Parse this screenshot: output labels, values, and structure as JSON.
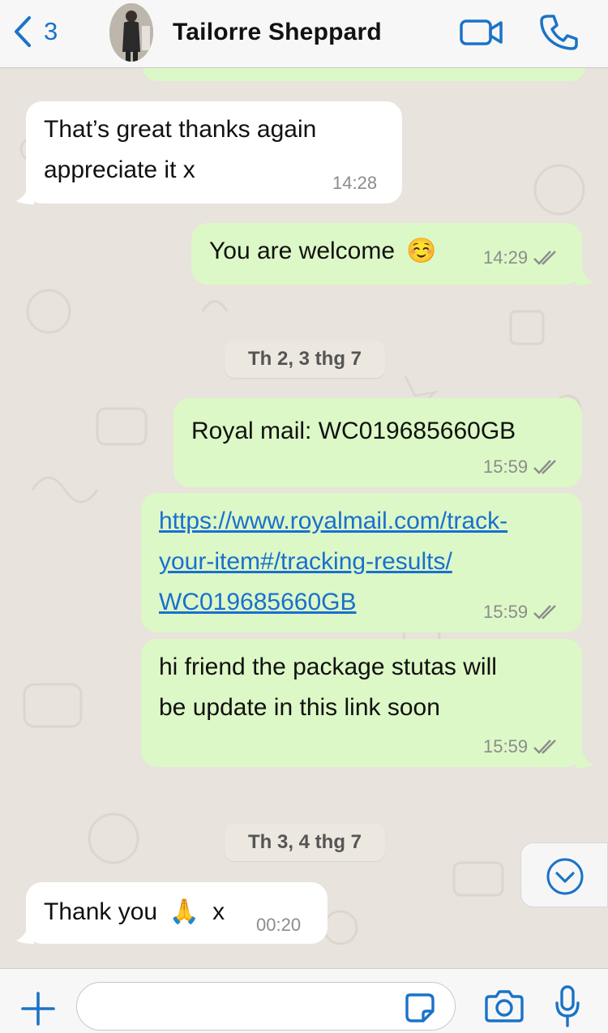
{
  "header": {
    "back_count": "3",
    "contact_name": "Tailorre Sheppard",
    "accent_color": "#1a73c8"
  },
  "messages": [
    {
      "direction": "incoming",
      "text_lines": [
        "That’s great thanks again",
        "appreciate it x"
      ],
      "time": "14:28"
    },
    {
      "direction": "outgoing",
      "text": "You are welcome",
      "emoji": "☺️",
      "time": "14:29",
      "status": "read"
    },
    {
      "direction": "outgoing",
      "text": "Royal mail: WC019685660GB",
      "time": "15:59",
      "status": "read"
    },
    {
      "direction": "outgoing",
      "link_lines": [
        "https://www.royalmail.com/track-",
        "your-item#/tracking-results/",
        "WC019685660GB"
      ],
      "time": "15:59",
      "status": "read"
    },
    {
      "direction": "outgoing",
      "text_lines": [
        "hi friend the package stutas will",
        "be update in this link soon"
      ],
      "time": "15:59",
      "status": "read"
    },
    {
      "direction": "incoming",
      "text": "Thank you",
      "emoji": "🙏",
      "suffix": "x",
      "time": "00:20"
    }
  ],
  "date_separators": [
    "Th 2, 3 thg 7",
    "Th 3, 4 thg 7"
  ],
  "colors": {
    "incoming_bubble": "#ffffff",
    "outgoing_bubble": "#dcf8c6",
    "chat_background": "#e8e3dc",
    "link": "#1a6fcf"
  },
  "composer": {
    "input_value": "",
    "icons": [
      "plus-icon",
      "sticker-icon",
      "camera-icon",
      "microphone-icon"
    ]
  },
  "scroll_down_icon": "chevron-down-circle-icon"
}
